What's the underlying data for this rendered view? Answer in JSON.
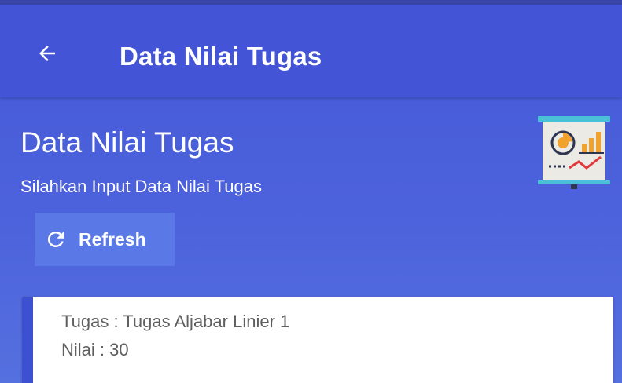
{
  "appbar": {
    "back_icon": "arrow-left-icon",
    "title": "Data Nilai Tugas"
  },
  "header": {
    "title": "Data Nilai Tugas",
    "subtitle": "Silahkan Input Data Nilai Tugas",
    "illustration_icon": "presentation-chart-icon"
  },
  "refresh": {
    "icon": "refresh-icon",
    "label": "Refresh"
  },
  "items": [
    {
      "tugas_line": "Tugas : Tugas Aljabar Linier 1",
      "nilai_line": "Nilai : 30"
    }
  ],
  "colors": {
    "primary": "#4355d6",
    "background": "#4d63dc",
    "button": "#5a78e6",
    "card": "#ffffff",
    "card_accent": "#3d50d2",
    "card_text": "#5f5f5f"
  }
}
